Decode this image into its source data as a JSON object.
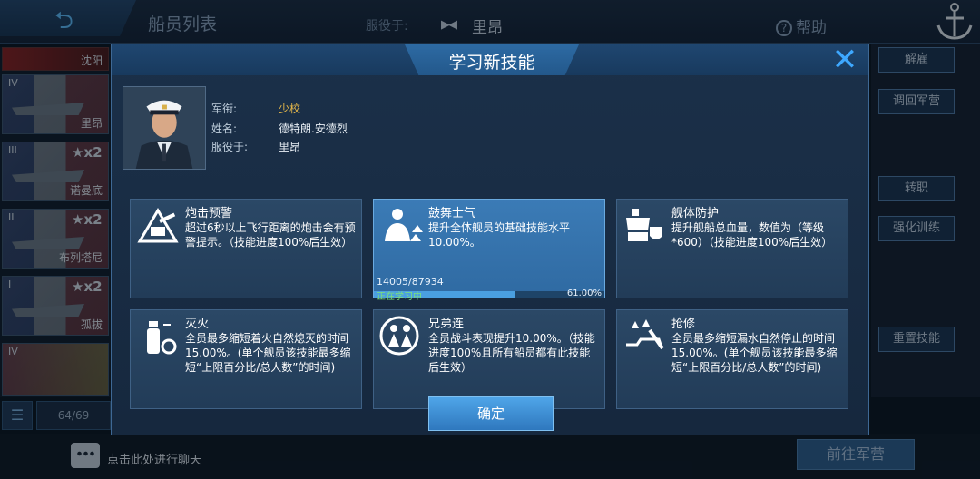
{
  "screen": {
    "title": "船员列表",
    "serve_label": "服役于:",
    "serve_flag": "▶◀",
    "serve_ship": "里昂",
    "help_label": "帮助"
  },
  "ship_list": {
    "top_card_name": "沈阳",
    "cards": [
      {
        "tier": "IV",
        "star": "",
        "name": "里昂"
      },
      {
        "tier": "III",
        "star": "★x2",
        "name": "诺曼底"
      },
      {
        "tier": "II",
        "star": "★x2",
        "name": "布列塔尼"
      },
      {
        "tier": "I",
        "star": "★x2",
        "name": "孤拔"
      },
      {
        "tier": "IV",
        "star": "",
        "name": ""
      }
    ],
    "count": "64/69"
  },
  "right_buttons": [
    "解雇",
    "调回军营",
    "转职",
    "强化训练",
    "重置技能"
  ],
  "bottom": {
    "chat_text": "点击此处进行聊天",
    "goto_button": "前往军营"
  },
  "modal": {
    "title": "学习新技能",
    "close_symbol": "✕",
    "officer": {
      "rank_label": "军衔:",
      "rank_value": "少校",
      "name_label": "姓名:",
      "name_value": "德特朗.安德烈",
      "serve_label": "服役于:",
      "serve_value": "里昂"
    },
    "skills": [
      {
        "icon": "turret-warning-icon",
        "name": "炮击预警",
        "desc": "超过6秒以上飞行距离的炮击会有预警提示。（技能进度100%后生效）"
      },
      {
        "icon": "morale-boost-icon",
        "name": "鼓舞士气",
        "desc": "提升全体舰员的基础技能水平10.00%。",
        "progress_text": "14005/87934",
        "progress_status": "正在学习中",
        "progress_pct": "61.00%",
        "progress_fraction": 0.61
      },
      {
        "icon": "hull-protection-icon",
        "name": "舰体防护",
        "desc": "提升舰船总血量，数值为（等级*600）（技能进度100%后生效）"
      },
      {
        "icon": "fire-extinguisher-icon",
        "name": "灭火",
        "desc": "全员最多缩短着火自然熄灭的时间15.00%。(单个舰员该技能最多缩短“上限百分比/总人数”的时间)"
      },
      {
        "icon": "brotherhood-icon",
        "name": "兄弟连",
        "desc": "全员战斗表现提升10.00%。（技能进度100%且所有船员都有此技能后生效）"
      },
      {
        "icon": "repair-icon",
        "name": "抢修",
        "desc": "全员最多缩短漏水自然停止的时间15.00%。(单个舰员该技能最多缩短“上限百分比/总人数”的时间)"
      }
    ],
    "confirm_label": "确定"
  }
}
